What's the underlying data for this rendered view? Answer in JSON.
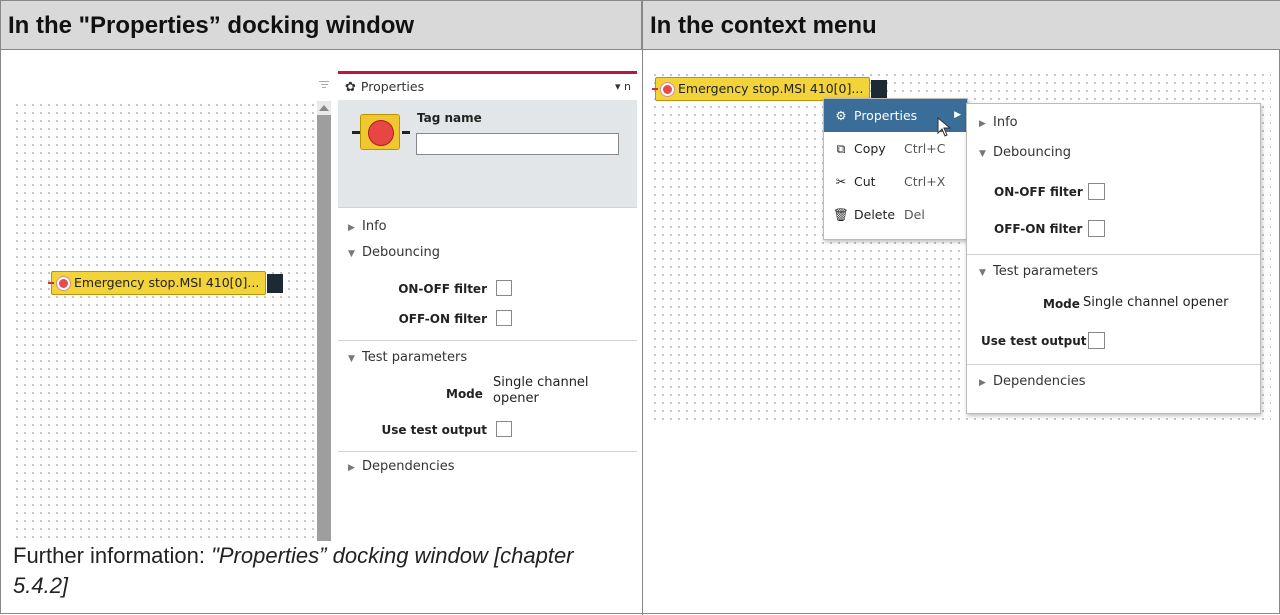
{
  "headers": {
    "left": "In the \"Properties” docking window",
    "right": "In the context menu"
  },
  "tag_label": "Emergency stop.MSI 410[0]...",
  "properties_panel": {
    "title": "Properties",
    "tools": "▾ ո",
    "tag_name_label": "Tag name",
    "tag_name_value": "",
    "sections": {
      "info": "Info",
      "debouncing": "Debouncing",
      "test_parameters": "Test parameters",
      "dependencies": "Dependencies"
    },
    "fields": {
      "on_off_filter": "ON-OFF filter",
      "off_on_filter": "OFF-ON filter",
      "mode_label": "Mode",
      "mode_value_left": "Single channel\nopener",
      "mode_value": "Single channel opener",
      "use_test_output": "Use test output"
    }
  },
  "context_menu": {
    "items": [
      {
        "label": "Properties",
        "shortcut": ""
      },
      {
        "label": "Copy",
        "shortcut": "Ctrl+C"
      },
      {
        "label": "Cut",
        "shortcut": "Ctrl+X"
      },
      {
        "label": "Delete",
        "shortcut": "Del"
      }
    ]
  },
  "further": {
    "prefix": "Further information: ",
    "link": "\"Properties” docking window [chapter 5.4.2]"
  },
  "icons": {
    "gear": "gear-icon",
    "copy": "copy-icon",
    "cut": "scissors-icon",
    "delete": "trash-icon"
  }
}
